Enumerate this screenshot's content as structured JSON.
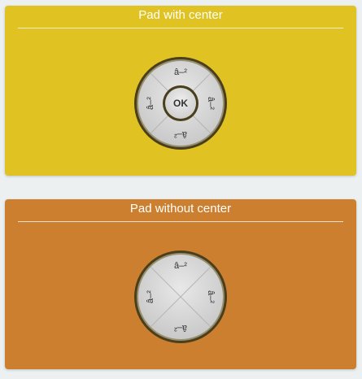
{
  "colors": {
    "page_background": "#ecf0f1",
    "card1_background": "#e0c322",
    "card2_background": "#cd7f30",
    "pad_ring": "#4a3f1c",
    "pad_face": "#d9d9d9"
  },
  "pad_with_center": {
    "title": "Pad with center",
    "up_label": "â–²",
    "down_label": "â–²",
    "left_label": "â–²",
    "right_label": "â–²",
    "center_label": "OK"
  },
  "pad_without_center": {
    "title": "Pad without center",
    "up_label": "â–²",
    "down_label": "â–²",
    "left_label": "â–²",
    "right_label": "â–²"
  }
}
